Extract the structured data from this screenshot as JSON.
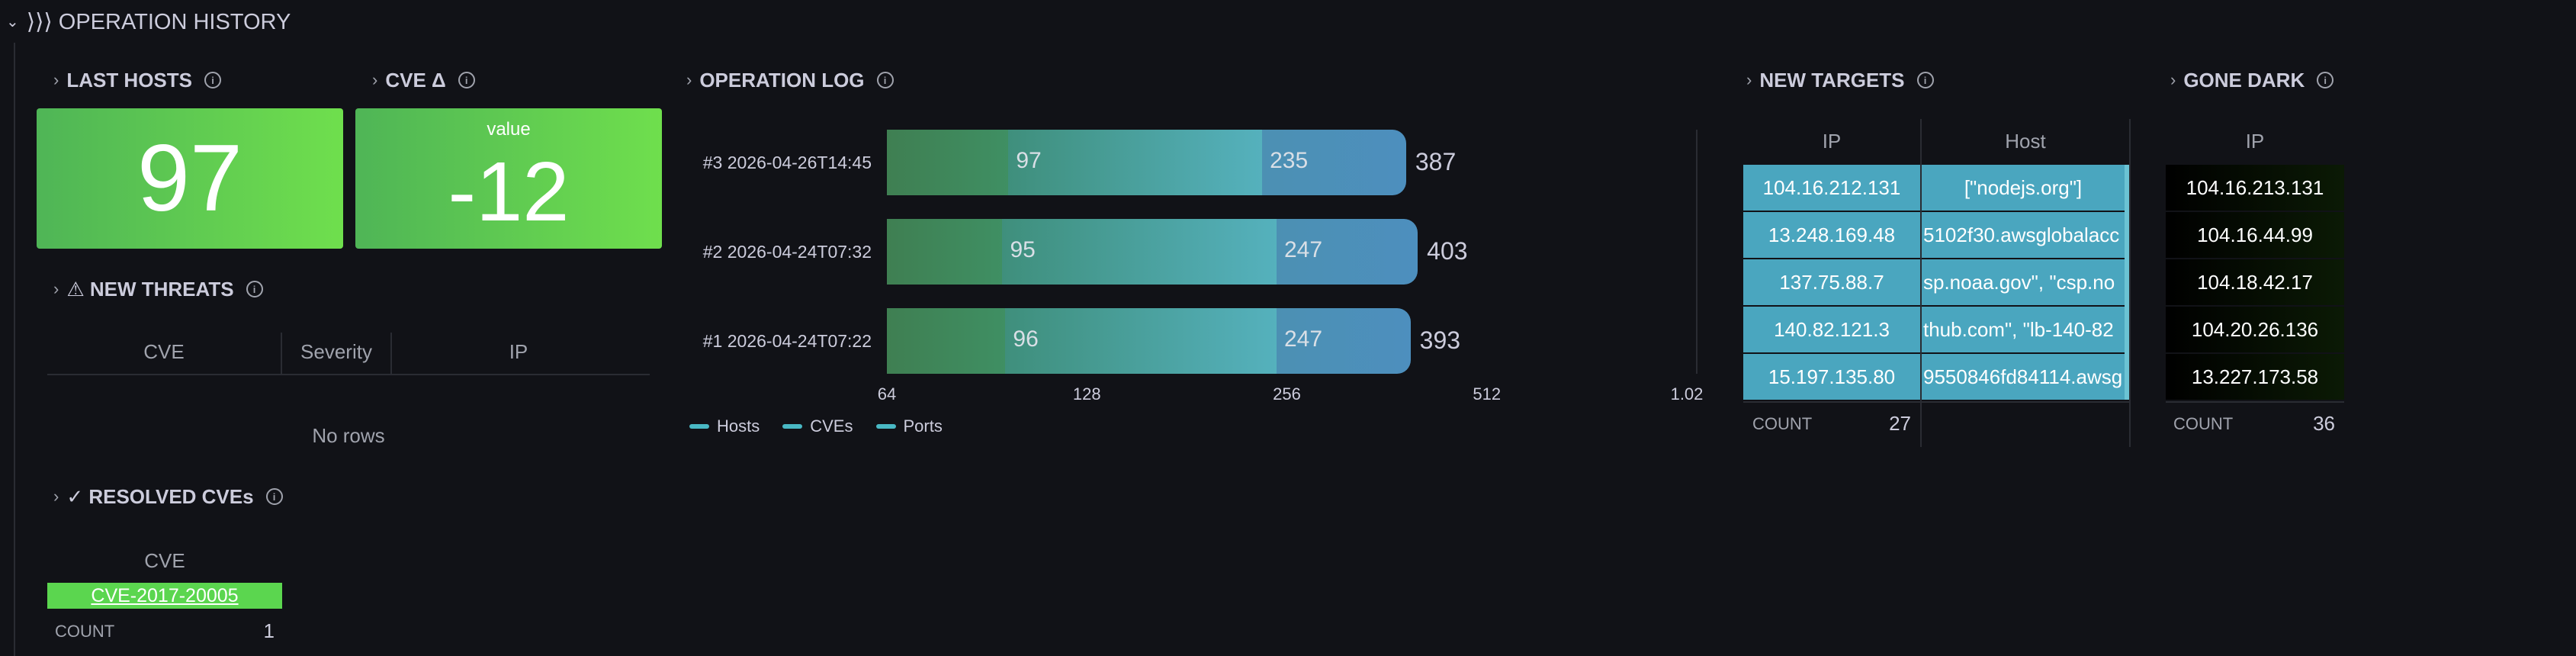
{
  "row": {
    "title": "⟩⟩⟩ OPERATION HISTORY"
  },
  "panels": {
    "last_hosts": {
      "title": "LAST HOSTS",
      "value": "97"
    },
    "cve_delta": {
      "title": "CVE Δ",
      "caption": "value",
      "value": "-12"
    },
    "new_threats": {
      "title": "⚠ NEW THREATS",
      "columns": [
        "CVE",
        "Severity",
        "IP"
      ],
      "empty_text": "No rows"
    },
    "resolved_cves": {
      "title": "✓ RESOLVED CVEs",
      "column": "CVE",
      "rows": [
        "CVE-2017-20005"
      ],
      "count_label": "COUNT",
      "count_value": "1"
    },
    "operation_log": {
      "title": "OPERATION LOG",
      "legend": [
        "Hosts",
        "CVEs",
        "Ports"
      ]
    },
    "new_targets": {
      "title": "NEW TARGETS",
      "columns": [
        "IP",
        "Host"
      ],
      "rows": [
        {
          "ip": "104.16.212.131",
          "host": "[\"nodejs.org\"]"
        },
        {
          "ip": "13.248.169.48",
          "host": "5102f30.awsglobalacc"
        },
        {
          "ip": "137.75.88.7",
          "host": "sp.noaa.gov\", \"csp.no"
        },
        {
          "ip": "140.82.121.3",
          "host": "thub.com\", \"lb-140-82"
        },
        {
          "ip": "15.197.135.80",
          "host": "9550846fd84114.awsg"
        }
      ],
      "count_label": "COUNT",
      "count_value": "27"
    },
    "gone_dark": {
      "title": "GONE DARK",
      "column": "IP",
      "rows": [
        "104.16.213.131",
        "104.16.44.99",
        "104.18.42.17",
        "104.20.26.136",
        "13.227.173.58"
      ],
      "count_label": "COUNT",
      "count_value": "36"
    }
  },
  "colors": {
    "background": "#111217",
    "stat_green_start": "#4fb556",
    "stat_green_end": "#6fdf4d",
    "host_cell": "#4aa6bf",
    "resolved_cve_bg": "#5bd64f",
    "gone_dark_bg": "#0b1a05",
    "series_hosts": "#3f8c5a",
    "series_cves": "#52a8b8",
    "series_ports": "#4c8fbe"
  },
  "chart_data": {
    "type": "bar",
    "orientation": "horizontal",
    "stacked": true,
    "categories": [
      "#3 2026-04-26T14:45",
      "#2 2026-04-24T07:32",
      "#1 2026-04-24T07:22"
    ],
    "series": [
      {
        "name": "Hosts",
        "values": [
          97,
          95,
          96
        ]
      },
      {
        "name": "CVEs",
        "values": [
          235,
          247,
          247
        ]
      },
      {
        "name": "Ports",
        "values": [
          387,
          403,
          393
        ]
      }
    ],
    "x_scale": "log2",
    "x_ticks": [
      "64",
      "128",
      "256",
      "512",
      "1.02"
    ],
    "xlim": [
      64,
      1024
    ],
    "legend_position": "bottom-left",
    "grid": false
  }
}
